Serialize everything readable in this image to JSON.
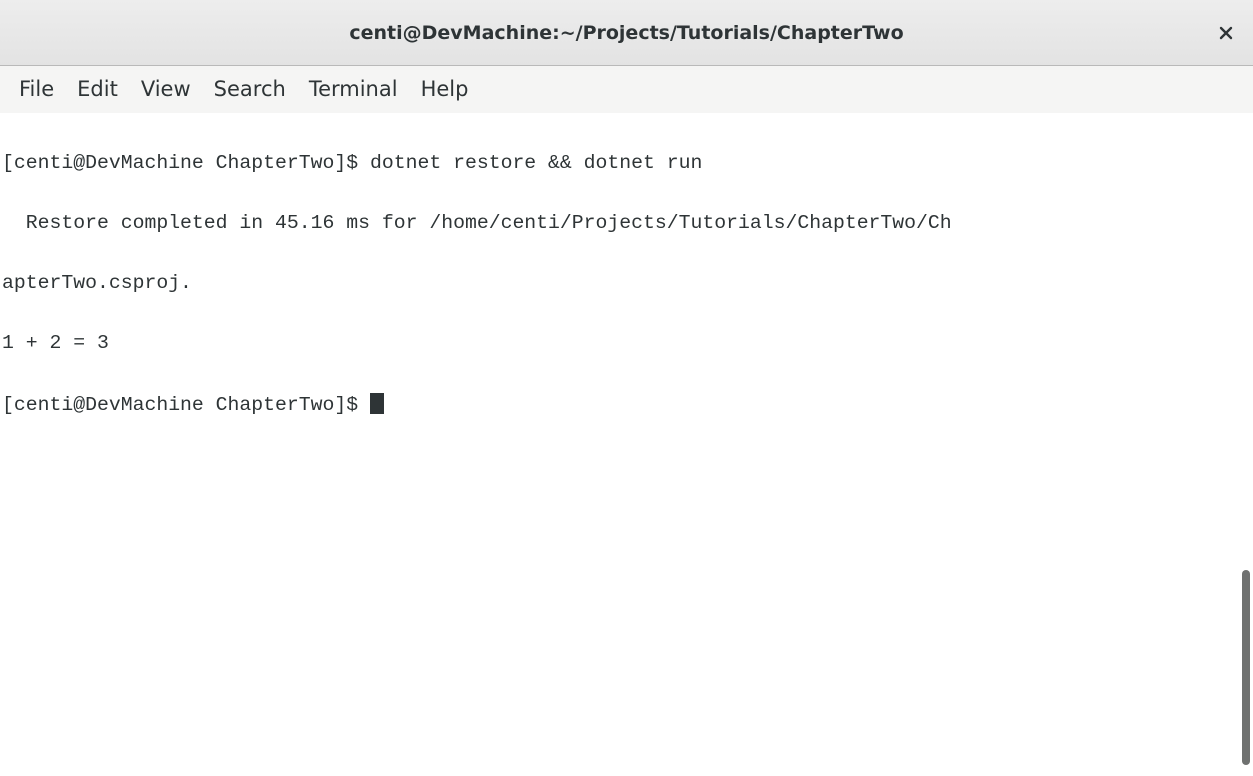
{
  "window": {
    "title": "centi@DevMachine:~/Projects/Tutorials/ChapterTwo",
    "close_icon": "close-icon"
  },
  "menu": {
    "items": [
      "File",
      "Edit",
      "View",
      "Search",
      "Terminal",
      "Help"
    ]
  },
  "terminal": {
    "lines": [
      "[centi@DevMachine ChapterTwo]$ dotnet restore && dotnet run",
      "  Restore completed in 45.16 ms for /home/centi/Projects/Tutorials/ChapterTwo/Ch",
      "apterTwo.csproj.",
      "1 + 2 = 3"
    ],
    "prompt": "[centi@DevMachine ChapterTwo]$ "
  },
  "colors": {
    "titlebar": "#e8e8e7",
    "text": "#2e3436",
    "background": "#ffffff",
    "scrollbar_thumb": "#6f7170"
  }
}
